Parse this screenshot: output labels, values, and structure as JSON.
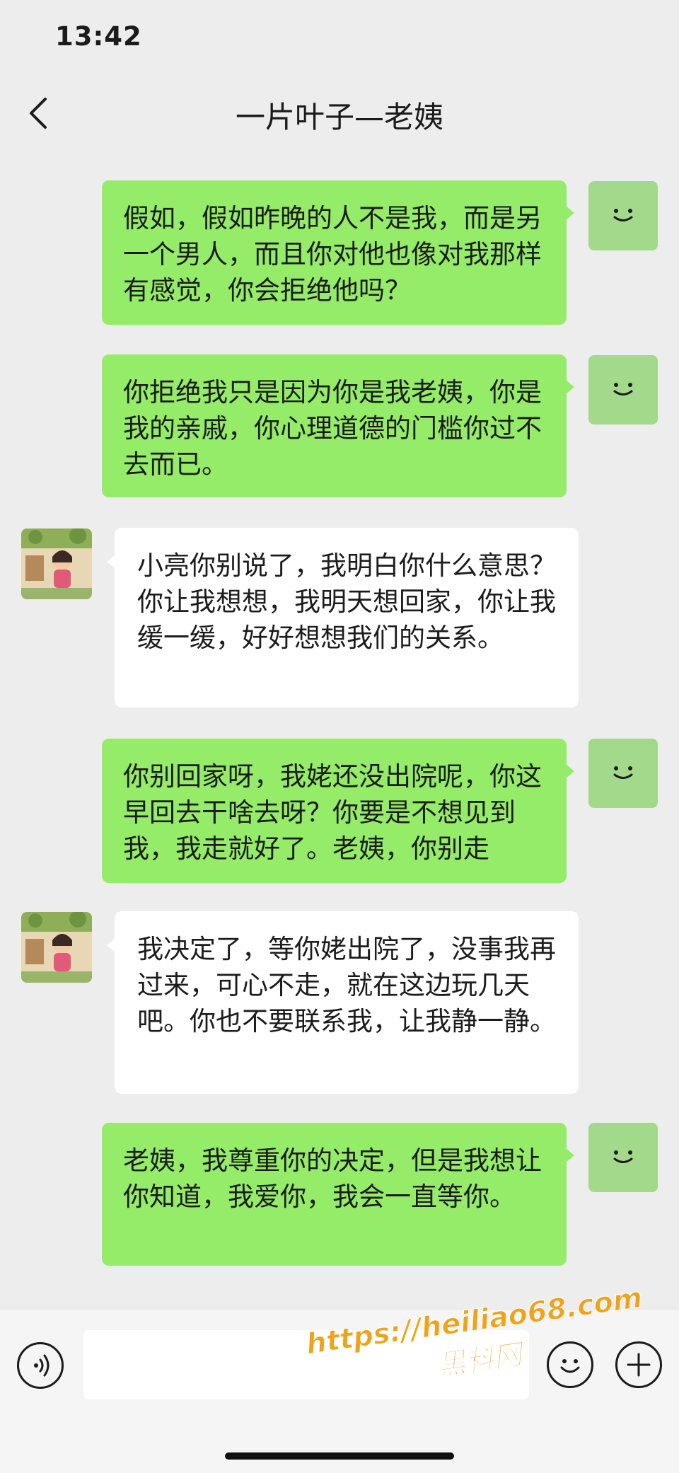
{
  "status_bar": {
    "time": "13:42"
  },
  "nav": {
    "title": "一片叶子—老姨"
  },
  "messages": [
    {
      "from": "me",
      "text": "假如，假如昨晚的人不是我，而是另一个男人，而且你对他也像对我那样有感觉，你会拒绝他吗？"
    },
    {
      "from": "me",
      "text": "你拒绝我只是因为你是我老姨，你是我的亲戚，你心理道德的门槛你过不去而已。"
    },
    {
      "from": "other",
      "text": "小亮你别说了，我明白你什么意思？你让我想想，我明天想回家，你让我缓一缓，好好想想我们的关系。"
    },
    {
      "from": "me",
      "text": "你别回家呀，我姥还没出院呢，你这早回去干啥去呀？你要是不想见到我，我走就好了。老姨，你别走"
    },
    {
      "from": "other",
      "text": "我决定了，等你姥出院了，没事我再过来，可心不走，就在这边玩几天吧。你也不要联系我，让我静一静。"
    },
    {
      "from": "me",
      "text": "老姨，我尊重你的决定，但是我想让你知道，我爱你，我会一直等你。"
    }
  ],
  "input": {
    "placeholder": ""
  },
  "watermark": {
    "url": "https://heiliao68.com",
    "name": "黑料网"
  },
  "colors": {
    "outgoing_bubble": "#95ec69",
    "incoming_bubble": "#ffffff",
    "background": "#ededed",
    "watermark": "#f0a21b"
  },
  "icons": {
    "back": "chevron-left-icon",
    "voice": "voice-icon",
    "emoji": "emoji-icon",
    "plus": "plus-icon",
    "my_avatar": "smiley-avatar",
    "other_avatar": "cartoon-girl-avatar"
  }
}
